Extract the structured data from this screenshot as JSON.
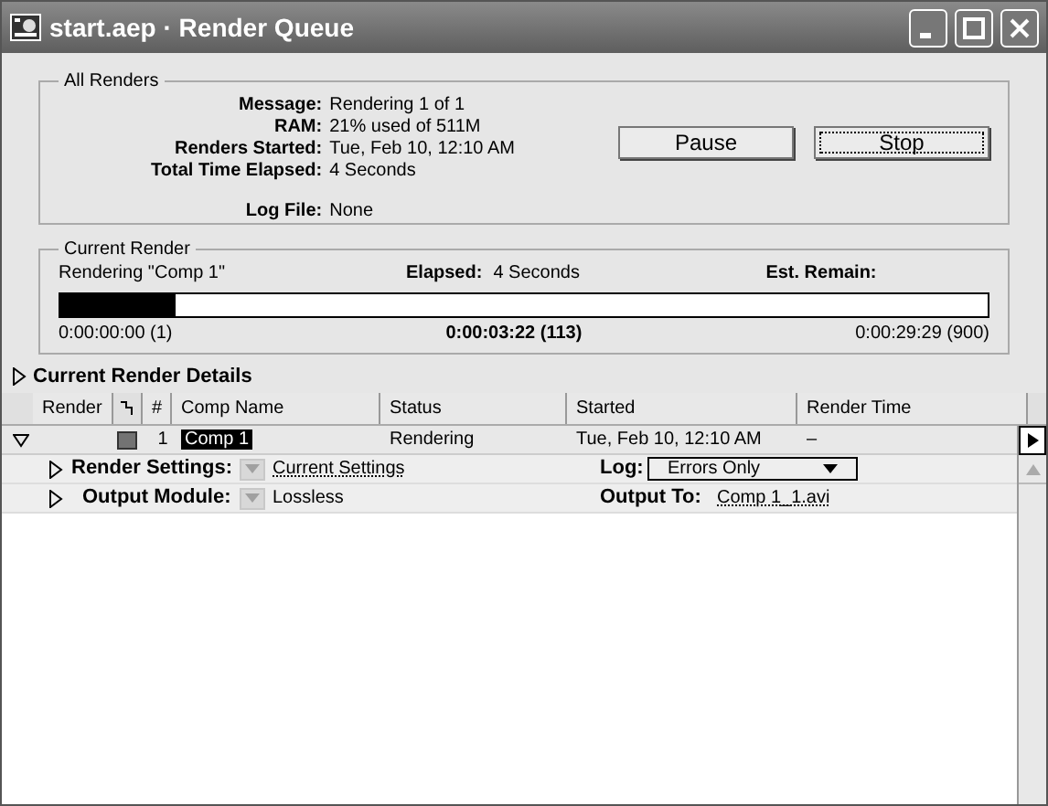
{
  "window": {
    "title": "start.aep · Render Queue"
  },
  "all_renders": {
    "title": "All Renders",
    "fields": [
      {
        "label": "Message:",
        "value": "Rendering 1 of 1"
      },
      {
        "label": "RAM:",
        "value": "21% used of 511M"
      },
      {
        "label": "Renders Started:",
        "value": "Tue, Feb 10, 12:10 AM"
      },
      {
        "label": "Total Time Elapsed:",
        "value": "4 Seconds"
      }
    ],
    "log_file": {
      "label": "Log File:",
      "value": "None"
    },
    "buttons": [
      {
        "label": "Pause",
        "focused": false
      },
      {
        "label": "Stop",
        "focused": true
      }
    ]
  },
  "current_render": {
    "title": "Current Render",
    "rendering": "Rendering \"Comp 1\"",
    "elapsed_label": "Elapsed:",
    "elapsed": "4 Seconds",
    "remain_label": "Est. Remain:",
    "level": 0.125,
    "start": "0:00:00:00 (1)",
    "current": "0:00:03:22 (113)",
    "end": "0:00:29:29 (900)"
  },
  "details": {
    "label": "Current Render Details",
    "expanded": false
  },
  "table": {
    "columns": [
      "Render",
      "#",
      "Comp Name",
      "Status",
      "Started",
      "Render Time"
    ],
    "rows": [
      {
        "expanded": true,
        "color": "#737373",
        "number": "1",
        "comp_name": "Comp 1",
        "selected": true,
        "status": "Rendering",
        "started": "Tue, Feb 10, 12:10 AM",
        "render_time": "–",
        "render_settings": {
          "label": "Render Settings:",
          "value": "Current Settings",
          "log_label": "Log:",
          "log_value": "Errors Only"
        },
        "output_module": {
          "label": "Output Module:",
          "value": "Lossless",
          "output_label": "Output To:",
          "output_value": "Comp 1_1.avi"
        }
      }
    ]
  }
}
